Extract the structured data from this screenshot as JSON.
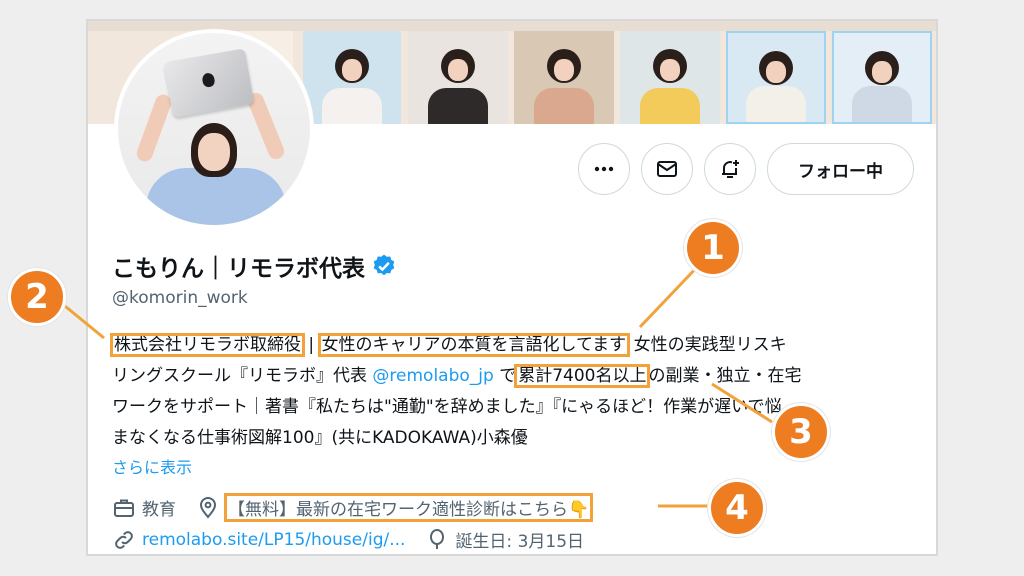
{
  "profile": {
    "display_name": "こもりん｜リモラボ代表",
    "handle": "@komorin_work",
    "follow_label": "フォロー中",
    "bio": {
      "part_company": "株式会社リモラボ取締役",
      "sep": "|",
      "part_tagline": "女性のキャリアの本質を言語化してます",
      "line1_rest": "女性の実践型リスキ",
      "line2_pre": "リングスクール『リモラボ』代表",
      "line2_mention": "@remolabo_jp",
      "line2_mid": "で",
      "line2_count": "累計7400名以上",
      "line2_post": "の副業・独立・在宅",
      "line3": "ワークをサポート｜著書『私たちは\"通勤\"を辞めました』『にゃるほど！作業が遅いで悩",
      "line4": "まなくなる仕事術図解100』(共にKADOKAWA)小森優"
    },
    "show_more": "さらに表示",
    "category": "教育",
    "location": "【無料】最新の在宅ワーク適性診断はこちら👇",
    "website": "remolabo.site/LP15/house/ig/...",
    "birthday": "誕生日: 3月15日"
  },
  "callouts": [
    "1",
    "2",
    "3",
    "4"
  ],
  "colors": {
    "accent": "#1d9bf0",
    "highlight": "#f2a23a",
    "callout": "#ee7d22",
    "muted": "#536471"
  },
  "icons": [
    "more-icon",
    "mail-icon",
    "notification-add-icon",
    "verified-icon",
    "briefcase-icon",
    "location-pin-icon",
    "link-icon",
    "balloon-icon"
  ]
}
